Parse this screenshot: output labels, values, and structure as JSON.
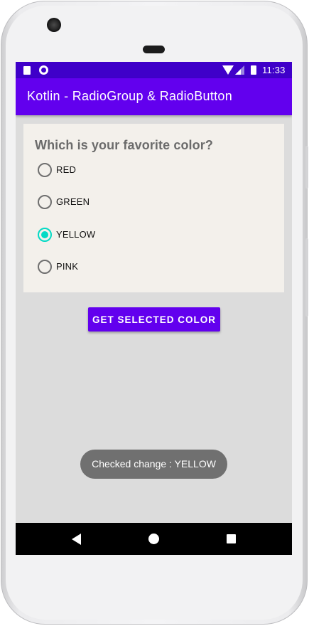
{
  "status_bar": {
    "time": "11:33",
    "left_icons": [
      "sd-card-icon",
      "record-icon"
    ],
    "right_icons": [
      "wifi-icon",
      "signal-icon",
      "battery-icon"
    ]
  },
  "app_bar": {
    "title": "Kotlin - RadioGroup & RadioButton"
  },
  "question": "Which is your favorite color?",
  "radio_options": [
    {
      "label": "RED",
      "checked": false
    },
    {
      "label": "GREEN",
      "checked": false
    },
    {
      "label": "YELLOW",
      "checked": true
    },
    {
      "label": "PINK",
      "checked": false
    }
  ],
  "button": {
    "label": "GET SELECTED COLOR"
  },
  "toast": {
    "text": "Checked change : YELLOW"
  },
  "nav_bar": {
    "icons": [
      "back-icon",
      "home-icon",
      "recents-icon"
    ]
  },
  "colors": {
    "primary": "#6200ee",
    "primary_dark": "#3f00c9",
    "accent": "#03dac5",
    "card": "#f3f0eb",
    "background": "#dcdcdc",
    "toast": "#707070"
  }
}
